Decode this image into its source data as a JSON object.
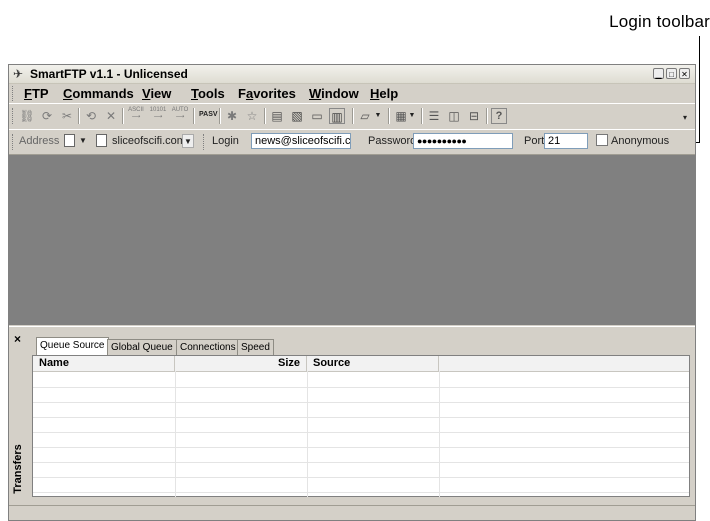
{
  "callout": {
    "label": "Login toolbar"
  },
  "window": {
    "title": "SmartFTP v1.1 - Unlicensed",
    "controls": [
      "minimize",
      "maximize",
      "close"
    ]
  },
  "menu": [
    {
      "label": "FTP",
      "accel": "F",
      "rest": "TP"
    },
    {
      "label": "Commands",
      "accel": "C",
      "rest": "ommands"
    },
    {
      "label": "View",
      "accel": "V",
      "rest": "iew"
    },
    {
      "label": "Tools",
      "accel": "T",
      "rest": "ools"
    },
    {
      "label": "Favorites",
      "pre": "F",
      "accel": "a",
      "rest": "vorites"
    },
    {
      "label": "Window",
      "accel": "W",
      "rest": "indow"
    },
    {
      "label": "Help",
      "accel": "H",
      "rest": "elp"
    }
  ],
  "toolbar": {
    "text_icons": {
      "ascii": "ASCII",
      "binary": "10101",
      "auto": "AUTO",
      "pasv": "PASV"
    },
    "icons": [
      "connect-icon",
      "reconnect-icon",
      "disconnect-icon",
      "refresh-icon",
      "stop-icon",
      "favorite-add-icon",
      "favorite-icon",
      "transfer-icon",
      "log-icon",
      "folder-icon",
      "remote-browser-icon",
      "folder-dropdown-icon",
      "view-dropdown-icon",
      "layout-horizontal-icon",
      "layout-vertical-icon",
      "layout-tile-icon",
      "help-icon"
    ]
  },
  "addressbar": {
    "address_label": "Address",
    "address_value": "sliceofscifi.com/",
    "login_label": "Login",
    "login_value": "news@sliceofscifi.co",
    "password_label": "Password",
    "password_value": "●●●●●●●●●●",
    "port_label": "Port",
    "port_value": "21",
    "anonymous_label": "Anonymous"
  },
  "transfers": {
    "panel_title": "Transfers",
    "close": "×",
    "tabs": [
      "Queue Source",
      "Global Queue",
      "Connections",
      "Speed"
    ],
    "active_tab": "Queue Source",
    "columns": [
      "Name",
      "Size",
      "Source"
    ]
  }
}
